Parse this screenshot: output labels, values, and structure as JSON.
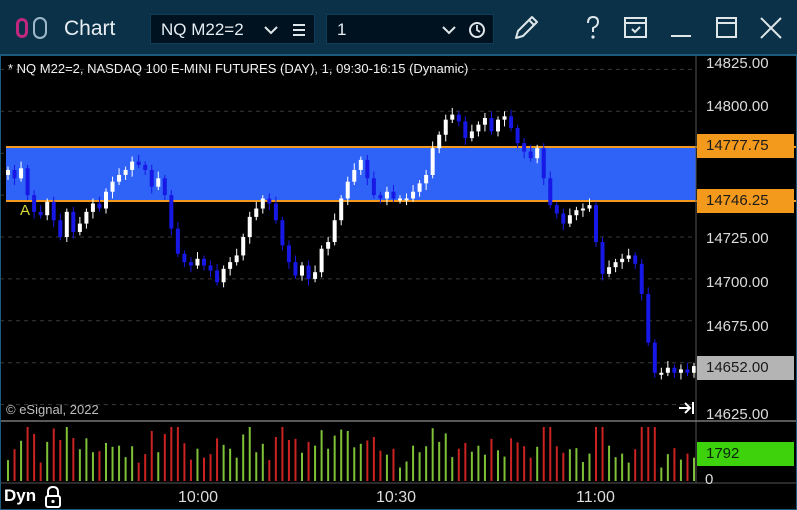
{
  "window": {
    "title": "Chart"
  },
  "toolbar": {
    "symbol": "NQ M22=2",
    "interval": "1",
    "icons": [
      "app-logo-icon",
      "list-icon",
      "clock-icon",
      "pencil-icon",
      "help-icon",
      "save-layout-icon",
      "minimize-icon",
      "maximize-icon",
      "close-icon"
    ]
  },
  "chart": {
    "header": "* NQ M22=2, NASDAQ 100 E-MINI FUTURES (DAY), 1, 09:30-16:15 (Dynamic)",
    "copyright": "© eSignal, 2022",
    "marker": "A",
    "price_labels": [
      "14825.00",
      "14800.00",
      "14725.00",
      "14700.00",
      "14675.00",
      "14625.00"
    ],
    "band_upper": "14777.75",
    "band_lower": "14746.25",
    "last_price": "14652.00",
    "volume_last": "1792",
    "volume_zero": "0",
    "time_labels": [
      "10:00",
      "10:30",
      "11:00"
    ],
    "mode": "Dyn",
    "colors": {
      "band": "#2f62f7",
      "band_edge": "#f39a1d",
      "up": "#ffffff",
      "down": "#1717e6",
      "vol_up": "#7fc238",
      "vol_down": "#cc2222",
      "last": "#b4b4b4",
      "volume_badge": "#3dd20b"
    }
  },
  "chart_data": {
    "type": "candlestick",
    "title": "* NQ M22=2, NASDAQ 100 E-MINI FUTURES (DAY), 1, 09:30-16:15 (Dynamic)",
    "ylim": [
      14620,
      14830
    ],
    "yticks": [
      14625,
      14650,
      14675,
      14700,
      14725,
      14750,
      14775,
      14800,
      14825
    ],
    "xticks": [
      "10:00",
      "10:30",
      "11:00"
    ],
    "band": [
      14746.25,
      14777.75
    ],
    "last": 14652.0,
    "close": [
      14765,
      14760,
      14766,
      14750,
      14740,
      14738,
      14746,
      14735,
      14725,
      14740,
      14728,
      14733,
      14740,
      14745,
      14742,
      14752,
      14758,
      14762,
      14765,
      14770,
      14768,
      14765,
      14755,
      14760,
      14750,
      14730,
      14715,
      14710,
      14708,
      14712,
      14708,
      14705,
      14698,
      14706,
      14710,
      14714,
      14725,
      14737,
      14742,
      14748,
      14745,
      14735,
      14720,
      14710,
      14702,
      14708,
      14700,
      14704,
      14718,
      14722,
      14735,
      14748,
      14758,
      14765,
      14771,
      14760,
      14750,
      14748,
      14752,
      14748,
      14748,
      14748,
      14752,
      14757,
      14762,
      14778,
      14786,
      14795,
      14798,
      14794,
      14784,
      14788,
      14792,
      14796,
      14788,
      14795,
      14797,
      14790,
      14781,
      14776,
      14772,
      14778,
      14760,
      14744,
      14739,
      14733,
      14738,
      14741,
      14742,
      14744,
      14722,
      14703,
      14707,
      14710,
      14712,
      14714,
      14709,
      14691,
      14662,
      14644,
      14644,
      14647,
      14644,
      14646,
      14644,
      14648
    ],
    "volume_last": 1792
  }
}
